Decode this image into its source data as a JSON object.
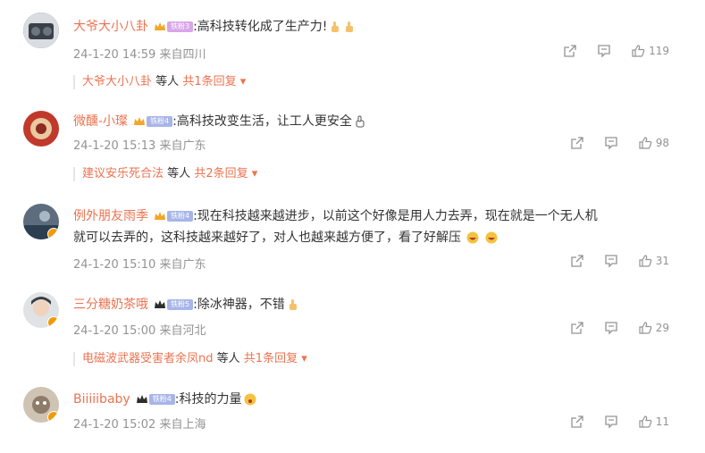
{
  "comments": [
    {
      "user": "大爷大小八卦",
      "badge": "铁粉3",
      "text": ":高科技转化成了生产力!",
      "time": "24-1-20 14:59",
      "location": "来自四川",
      "likes": "119",
      "reply_user": "大爷大小八卦",
      "reply_mid": "等人",
      "reply_link": "共1条回复",
      "avatar_color": "#444a52"
    },
    {
      "user": "微醺-小璨",
      "badge": "铁粉4",
      "text": ":高科技改变生活，让工人更安全",
      "time": "24-1-20 15:13",
      "location": "来自广东",
      "likes": "98",
      "reply_user": "建议安乐死合法",
      "reply_mid": "等人",
      "reply_link": "共2条回复",
      "avatar_color": "#c0392b"
    },
    {
      "user": "例外朋友雨季",
      "badge": "铁粉4",
      "text_line1": ":现在科技越来越进步，以前这个好像是用人力去弄，现在就是一个无人机",
      "text_line2": "就可以去弄的，这科技越来越好了，对人也越来越方便了，看了好解压",
      "time": "24-1-20 15:10",
      "location": "来自广东",
      "likes": "31",
      "avatar_color": "#2c3e50"
    },
    {
      "user": "三分糖奶茶哦",
      "badge": "铁粉5",
      "text": ":除冰神器，不错",
      "time": "24-1-20 15:00",
      "location": "来自河北",
      "likes": "29",
      "reply_user": "电磁波武器受害者余凤nd",
      "reply_mid": "等人",
      "reply_link": "共1条回复",
      "avatar_color": "#7f8c8d"
    },
    {
      "user": "Biiiiibaby",
      "badge": "铁粉4",
      "text": ":科技的力量",
      "time": "24-1-20 15:02",
      "location": "来自上海",
      "likes": "11",
      "avatar_color": "#8e7b6a"
    }
  ],
  "icons": {
    "share": "share-icon",
    "comment": "comment-icon",
    "like": "like-icon"
  },
  "colors": {
    "username": "#eb7350",
    "meta": "#939393"
  }
}
